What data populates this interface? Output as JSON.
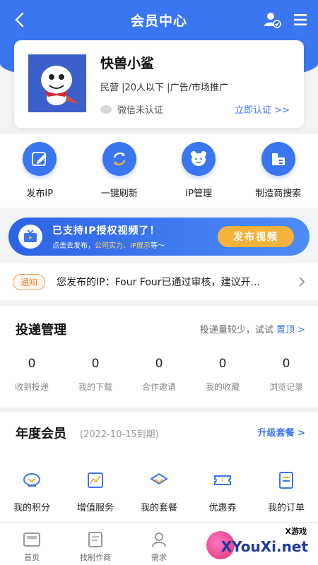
{
  "header": {
    "title": "会员中心",
    "back_icon": "back-arrow-icon",
    "user_icon": "user-verified-icon",
    "menu_icon": "menu-icon"
  },
  "profile": {
    "name": "快兽小鲨",
    "meta": "民营 |20人以下 |广告/市场推广",
    "wechat_status": "微信未认证",
    "verify_link": "立即认证 >>"
  },
  "quick_actions": [
    {
      "label": "发布IP",
      "icon": "edit-icon"
    },
    {
      "label": "一键刷新",
      "icon": "refresh-icon"
    },
    {
      "label": "IP管理",
      "icon": "bear-face-icon"
    },
    {
      "label": "制造商搜索",
      "icon": "factory-icon"
    }
  ],
  "banner": {
    "title": "已支持IP授权视频了！",
    "sub_prefix": "点击去发布，",
    "sub_highlight": "公司实力、IP展示",
    "sub_suffix": "等～",
    "button": "发布视频"
  },
  "notice": {
    "tag": "通知",
    "text": "您发布的IP：Four Four已通过审核，建议开..."
  },
  "delivery": {
    "title": "投递管理",
    "hint": "投递量较少，试试",
    "hint_link": "置顶 >",
    "stats": [
      {
        "value": "0",
        "label": "收到投递"
      },
      {
        "value": "0",
        "label": "我的下载"
      },
      {
        "value": "0",
        "label": "合作邀请"
      },
      {
        "value": "0",
        "label": "我的收藏"
      },
      {
        "value": "0",
        "label": "浏览记录"
      }
    ]
  },
  "membership": {
    "title": "年度会员",
    "expire": "(2022-10-15到期)",
    "upgrade": "升级套餐 >",
    "items": [
      {
        "label": "我的积分",
        "icon": "points-icon"
      },
      {
        "label": "增值服务",
        "icon": "chart-icon"
      },
      {
        "label": "我的套餐",
        "icon": "package-icon"
      },
      {
        "label": "优惠券",
        "icon": "coupon-icon"
      },
      {
        "label": "我的订单",
        "icon": "order-icon"
      }
    ]
  },
  "tabbar": [
    {
      "label": "首页",
      "icon": "home-icon"
    },
    {
      "label": "找制作商",
      "icon": "search-maker-icon"
    },
    {
      "label": "需求",
      "icon": "demand-icon"
    }
  ],
  "watermark": {
    "label": "X游戏",
    "main": "XYouXi.net"
  },
  "colors": {
    "primary": "#3a76f0",
    "banner_button": "#f5b23c",
    "notice_tag": "#e8843a"
  }
}
